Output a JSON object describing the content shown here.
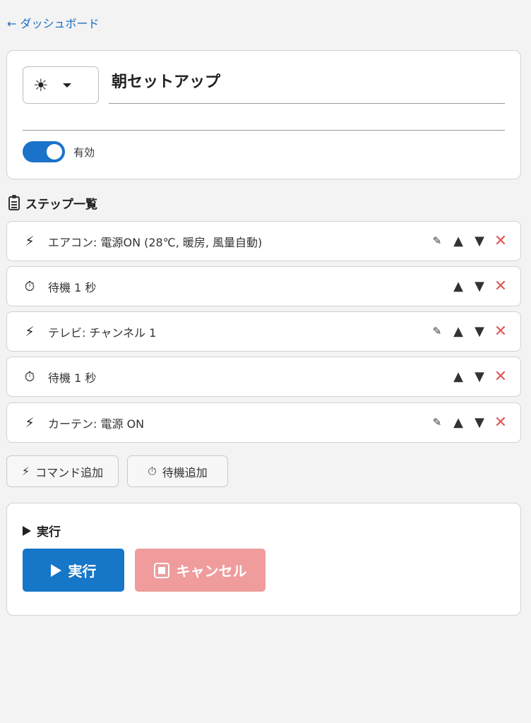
{
  "nav": {
    "back_label": "← ダッシュボード"
  },
  "scene": {
    "icon": "☀",
    "icon_name": "sun-icon",
    "name": "朝セットアップ",
    "description": "",
    "enabled": true,
    "enabled_label": "有効"
  },
  "steps_section": {
    "title": "ステップ一覧"
  },
  "steps": [
    {
      "type": "command",
      "label": "エアコン: 電源ON (28℃, 暖房, 風量自動)",
      "editable": true
    },
    {
      "type": "wait",
      "label": "待機 1 秒",
      "editable": false
    },
    {
      "type": "command",
      "label": "テレビ: チャンネル 1",
      "editable": true
    },
    {
      "type": "wait",
      "label": "待機 1 秒",
      "editable": false
    },
    {
      "type": "command",
      "label": "カーテン: 電源 ON",
      "editable": true
    }
  ],
  "step_actions": {
    "edit": "✎",
    "up": "▲",
    "down": "▼",
    "delete": "✕"
  },
  "add_buttons": {
    "command": "コマンド追加",
    "wait": "待機追加"
  },
  "run_section": {
    "title": "実行",
    "run_label": "実行",
    "cancel_label": "キャンセル"
  },
  "colors": {
    "accent": "#1676c8",
    "cancel": "#f09c9c",
    "delete": "#e05757",
    "link": "#1a6fc2"
  }
}
